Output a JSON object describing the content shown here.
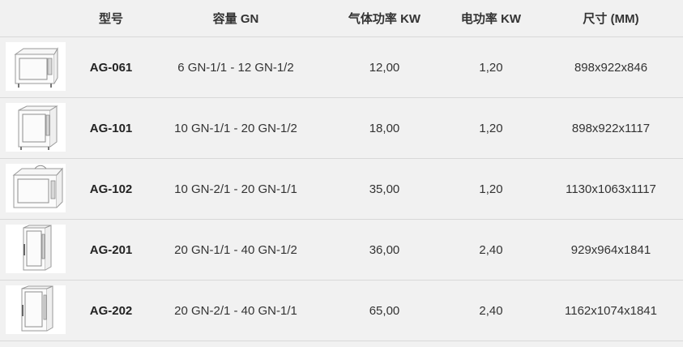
{
  "headers": {
    "model": "型号",
    "capacity": "容量 GN",
    "gas_power": "气体功率 KW",
    "electric_power": "电功率 KW",
    "dimensions": "尺寸 (MM)"
  },
  "rows": [
    {
      "image_icon": "oven-icon",
      "model": "AG-061",
      "capacity": "6 GN-1/1 - 12 GN-1/2",
      "gas_power": "12,00",
      "electric_power": "1,20",
      "dimensions": "898x922x846"
    },
    {
      "image_icon": "oven-icon",
      "model": "AG-101",
      "capacity": "10 GN-1/1 - 20 GN-1/2",
      "gas_power": "18,00",
      "electric_power": "1,20",
      "dimensions": "898x922x1117"
    },
    {
      "image_icon": "oven-icon",
      "model": "AG-102",
      "capacity": "10 GN-2/1 - 20 GN-1/1",
      "gas_power": "35,00",
      "electric_power": "1,20",
      "dimensions": "1130x1063x1117"
    },
    {
      "image_icon": "oven-icon",
      "model": "AG-201",
      "capacity": "20 GN-1/1 - 40 GN-1/2",
      "gas_power": "36,00",
      "electric_power": "2,40",
      "dimensions": "929x964x1841"
    },
    {
      "image_icon": "oven-icon",
      "model": "AG-202",
      "capacity": "20 GN-2/1 - 40 GN-1/1",
      "gas_power": "65,00",
      "electric_power": "2,40",
      "dimensions": "1162x1074x1841"
    }
  ],
  "colors": {
    "background": "#f1f1f1",
    "border": "#d8d8d8",
    "text": "#333333",
    "image_background": "#ffffff"
  }
}
